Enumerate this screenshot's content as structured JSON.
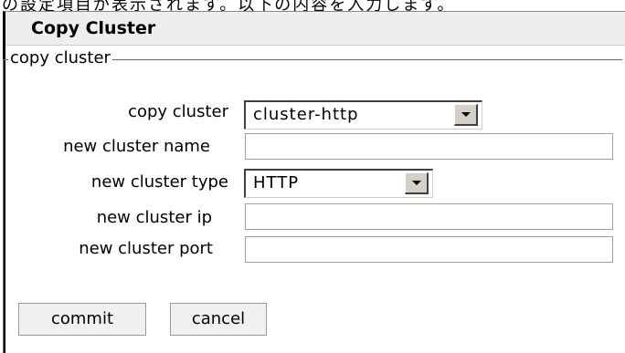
{
  "window": {
    "top_text": "の設定項目が表示されます。以下の内容を入力します。"
  },
  "panel": {
    "title": "Copy Cluster"
  },
  "fieldset": {
    "legend": "copy cluster"
  },
  "form": {
    "copy_cluster": {
      "label": "copy cluster",
      "selected": "cluster-http"
    },
    "new_cluster_name": {
      "label": "new cluster name",
      "value": ""
    },
    "new_cluster_type": {
      "label": "new cluster type",
      "selected": "HTTP"
    },
    "new_cluster_ip": {
      "label": "new cluster ip",
      "value": ""
    },
    "new_cluster_port": {
      "label": "new cluster port",
      "value": ""
    }
  },
  "actions": {
    "commit_label": "commit",
    "cancel_label": "cancel"
  }
}
